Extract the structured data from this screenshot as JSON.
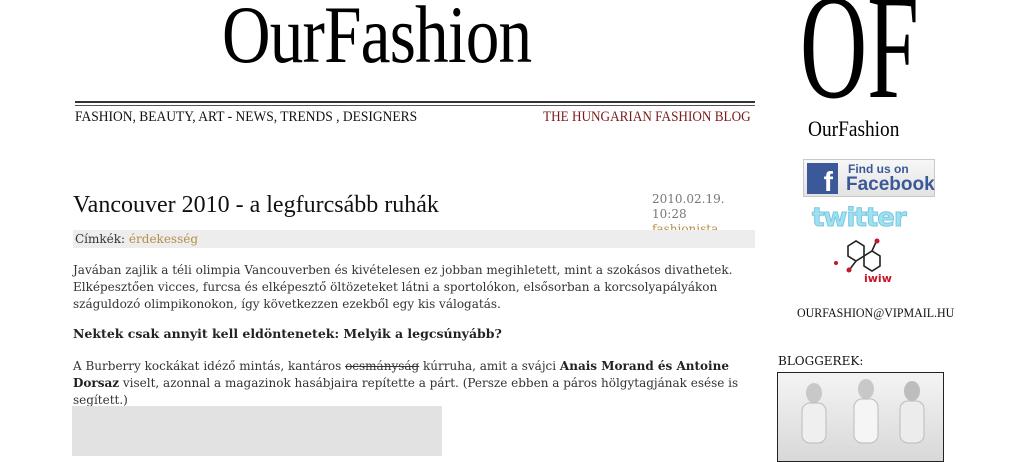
{
  "header": {
    "logo": "OurFashion",
    "nav": "FASHION, BEAUTY, ART -  NEWS, TRENDS , DESIGNERS",
    "tagline": "THE HUNGARIAN FASHION BLOG"
  },
  "post": {
    "title": "Vancouver 2010 - a legfurcsább ruhák",
    "date": "2010.02.19.",
    "time": "10:28",
    "author": "fashionista",
    "tags_label": "Címkék:",
    "tag": "érdekesség",
    "paragraph1": "Javában zajlik a téli olimpia Vancouverben és kivételesen ez jobban megihletett, mint a szokásos divathetek. Elképesztően vicces, furcsa és elképesztő öltözeteket látni a sportolókon, elsősorban a korcsolyapályákon száguldozó olimpikonokon, így következzen ezekből egy kis válogatás.",
    "paragraph2": "Nektek csak annyit kell eldöntenetek: Melyik a legcsúnyább?",
    "p3_a": "A Burberry kockákat idéző mintás, kantáros ",
    "p3_strike": "ocsmányság",
    "p3_b": " kúrruha, amit a svájci ",
    "p3_names": "Anais Morand és Antoine Dorsaz",
    "p3_c": " viselt, azonnal a magazinok hasábjaira repítette a párt. (Persze ebben a páros hölgytagjának esése is segített.)"
  },
  "sidebar": {
    "of_logo": "OF",
    "of_name": "OurFashion",
    "fb_find": "Find us on",
    "fb_word": "Facebook",
    "fb_letter": "f",
    "twitter": "twitter",
    "iwiw": "iwiw",
    "email": "OURFASHION@VIPMAIL.HU",
    "bloggers_label": "BLOGGEREK:"
  }
}
